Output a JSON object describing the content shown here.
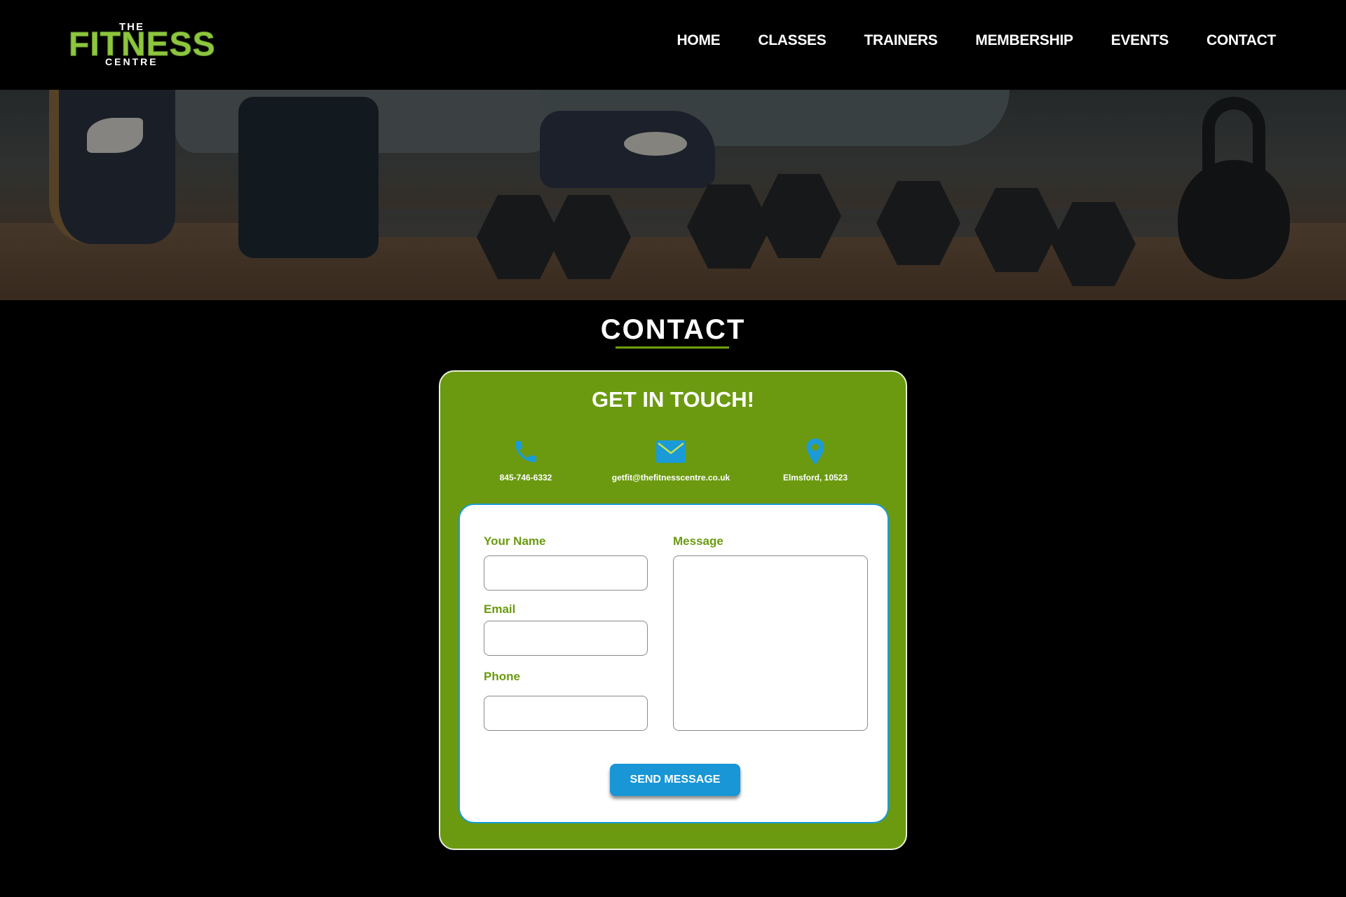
{
  "logo": {
    "line1": "THE",
    "line2": "FITNESS",
    "line3": "CENTRE"
  },
  "nav": {
    "items": [
      {
        "label": "HOME"
      },
      {
        "label": "CLASSES"
      },
      {
        "label": "TRAINERS"
      },
      {
        "label": "MEMBERSHIP"
      },
      {
        "label": "EVENTS"
      },
      {
        "label": "CONTACT"
      }
    ]
  },
  "page": {
    "title": "CONTACT"
  },
  "card": {
    "title": "GET IN TOUCH!",
    "phone": {
      "icon": "phone-icon",
      "text": "845-746-6332"
    },
    "email": {
      "icon": "envelope-icon",
      "text": "getfit@thefitnesscentre.co.uk"
    },
    "location": {
      "icon": "map-pin-icon",
      "text": "Elmsford, 10523"
    }
  },
  "form": {
    "name_label": "Your Name",
    "email_label": "Email",
    "phone_label": "Phone",
    "message_label": "Message",
    "submit_label": "SEND MESSAGE"
  },
  "colors": {
    "background": "#000000",
    "accent_green": "#6b9a10",
    "logo_green": "#8dc63f",
    "accent_blue": "#1896d6",
    "icon_blue": "#1a9bd7"
  }
}
